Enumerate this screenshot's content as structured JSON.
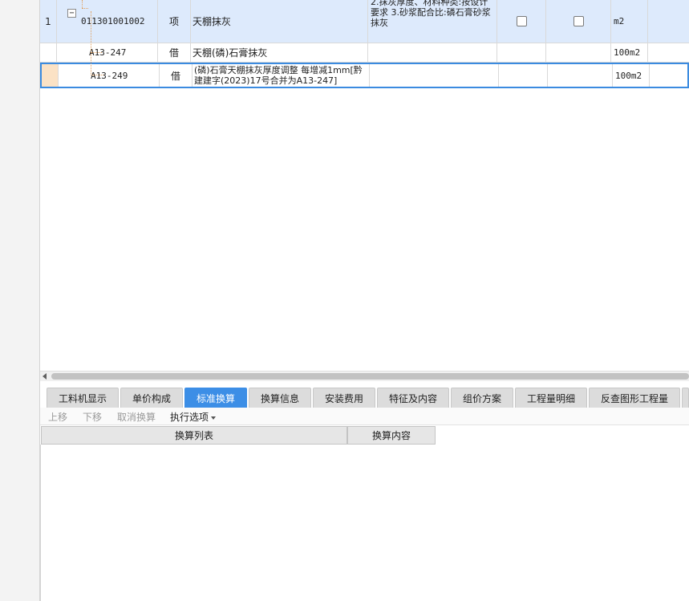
{
  "grid": {
    "rows": [
      {
        "index": "1",
        "code": "011301001002",
        "type": "项",
        "name": "天棚抹灰",
        "features": "2.抹灰厚度、材料种类:按设计要求\n3.砂浆配合比:磷石膏砂浆抹灰",
        "unit": "m2"
      },
      {
        "index": "",
        "code": "A13-247",
        "type": "借",
        "name": "天棚(磷)石膏抹灰",
        "features": "",
        "unit": "100m2"
      },
      {
        "index": "",
        "code": "A13-249",
        "type": "借",
        "name": "(磷)石膏天棚抹灰厚度调整 每增减1mm[黔建建字(2023)17号合并为A13-247]",
        "features": "",
        "unit": "100m2"
      }
    ],
    "toggle_symbol": "−"
  },
  "tabs": [
    {
      "label": "工料机显示"
    },
    {
      "label": "单价构成"
    },
    {
      "label": "标准换算"
    },
    {
      "label": "换算信息"
    },
    {
      "label": "安装费用"
    },
    {
      "label": "特征及内容"
    },
    {
      "label": "组价方案"
    },
    {
      "label": "工程量明细"
    },
    {
      "label": "反查图形工程量"
    }
  ],
  "active_tab": "标准换算",
  "toolbar": {
    "move_up": "上移",
    "move_down": "下移",
    "cancel_conversion": "取消换算",
    "execute_options": "执行选项"
  },
  "conversion_table": {
    "col_list": "换算列表",
    "col_content": "换算内容"
  },
  "colors": {
    "selected_row_bg": "#ddeafc",
    "active_tab_bg": "#3c8ee6",
    "focus_border": "#3b8be0",
    "row_marker": "#fbe2c5"
  }
}
